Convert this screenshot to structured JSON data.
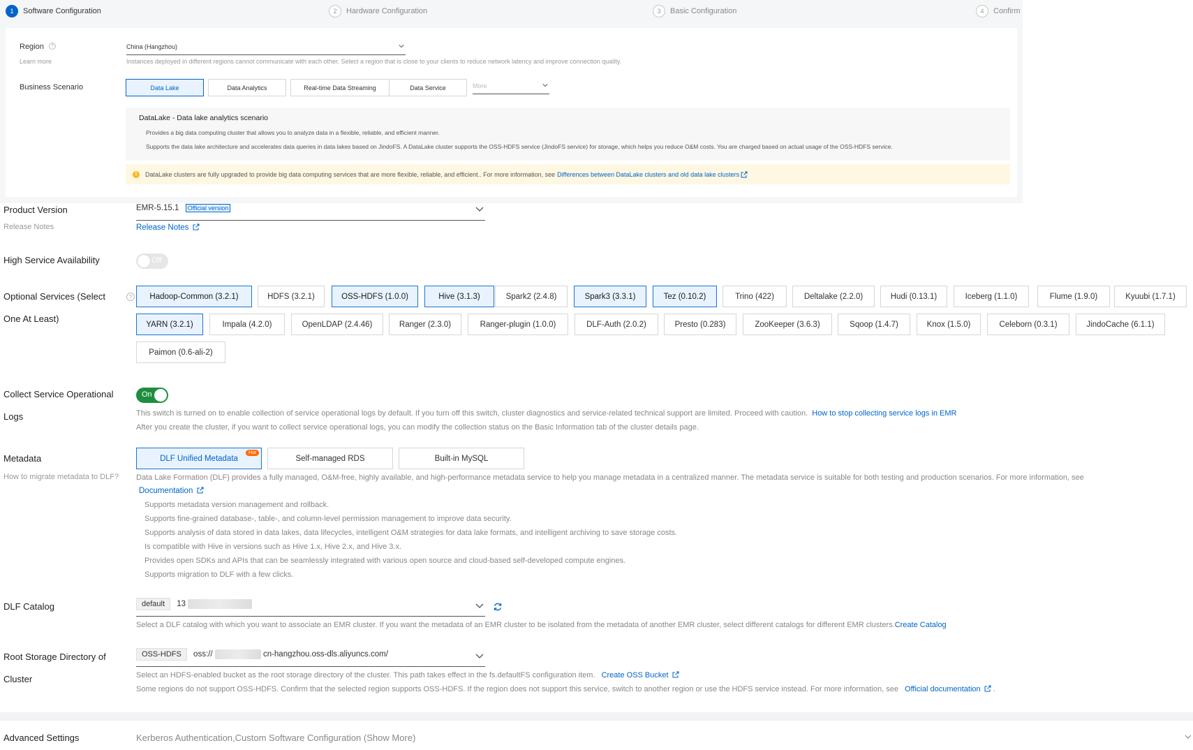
{
  "stepper": [
    {
      "num": "1",
      "label": "Software Configuration"
    },
    {
      "num": "2",
      "label": "Hardware Configuration"
    },
    {
      "num": "3",
      "label": "Basic Configuration"
    },
    {
      "num": "4",
      "label": "Confirm"
    }
  ],
  "region": {
    "label": "Region",
    "learn_more": "Learn more",
    "value": "China (Hangzhou)",
    "hint": "Instances deployed in different regions cannot communicate with each other. Select a region that is close to your clients to reduce network latency and improve connection quality."
  },
  "business": {
    "label": "Business Scenario",
    "options": [
      "Data Lake",
      "Data Analytics",
      "Real-time Data Streaming",
      "Data Service"
    ],
    "more_placeholder": "More",
    "scenario_title": "DataLake - Data lake analytics scenario",
    "scenario_line1": "Provides a big data computing cluster that allows you to analyze data in a flexible, reliable, and efficient manner.",
    "scenario_line2": "Supports the data lake architecture and accelerates data queries in data lakes based on JindoFS. A DataLake cluster supports the OSS-HDFS service (JindoFS service) for storage, which helps you reduce O&M costs. You are charged based on actual usage of the OSS-HDFS service.",
    "notice_text": "DataLake clusters are fully upgraded to provide big data computing services that are more flexible, reliable, and efficient.. For more information, see",
    "notice_link": "Differences between DataLake clusters and old data lake clusters"
  },
  "product_version": {
    "label": "Product Version",
    "sublabel": "Release Notes",
    "value": "EMR-5.15.1",
    "badge": "Official version",
    "link": "Release Notes"
  },
  "high_availability": {
    "label": "High Service Availability",
    "state": "Off"
  },
  "optional_services": {
    "label_line1": "Optional Services (Select",
    "label_line2": "One At Least)",
    "row1": [
      "Hadoop-Common (3.2.1)",
      "HDFS (3.2.1)",
      "OSS-HDFS (1.0.0)",
      "Hive (3.1.3)",
      "Spark2 (2.4.8)",
      "Spark3 (3.3.1)",
      "Tez (0.10.2)",
      "Trino (422)",
      "Deltalake (2.2.0)",
      "Hudi (0.13.1)",
      "Iceberg (1.1.0)",
      "Flume (1.9.0)",
      "Kyuubi (1.7.1)"
    ],
    "row2": [
      "YARN (3.2.1)",
      "Impala (4.2.0)",
      "OpenLDAP (2.4.46)",
      "Ranger (2.3.0)",
      "Ranger-plugin (1.0.0)",
      "DLF-Auth (2.0.2)",
      "Presto (0.283)",
      "ZooKeeper (3.6.3)",
      "Sqoop (1.4.7)",
      "Knox (1.5.0)",
      "Celeborn (0.3.1)",
      "JindoCache (6.1.1)"
    ],
    "row3": [
      "Paimon (0.6-ali-2)"
    ]
  },
  "collect_logs": {
    "label_line1": "Collect Service Operational",
    "label_line2": "Logs",
    "state": "On",
    "desc1": "This switch is turned on to enable collection of service operational logs by default. If you turn off this switch, cluster diagnostics and service-related technical support are limited. Proceed with caution.",
    "desc1_link": "How to stop collecting service logs in EMR",
    "desc2": "After you create the cluster, if you want to collect service operational logs, you can modify the collection status on the Basic Information tab of the cluster details page."
  },
  "metadata": {
    "label": "Metadata",
    "sublabel": "How to migrate metadata to DLF?",
    "options": [
      "DLF Unified Metadata",
      "Self-managed RDS",
      "Built-in MySQL"
    ],
    "hot": "Hot",
    "desc": "Data Lake Formation (DLF) provides a fully managed, O&M-free, highly available, and high-performance metadata service to help you manage metadata in a centralized manner. The metadata service is suitable for both testing and production scenarios. For more information, see",
    "doc_link": "Documentation",
    "bullets": [
      "Supports metadata version management and rollback.",
      "Supports fine-grained database-, table-, and column-level permission management to improve data security.",
      "Supports analysis of data stored in data lakes, data lifecycles, intelligent O&M strategies for data lake formats, and intelligent archiving to save storage costs.",
      "Is compatible with Hive in versions such as Hive 1.x, Hive 2.x, and Hive 3.x.",
      "Provides open SDKs and APIs that can be seamlessly integrated with various open source and cloud-based self-developed compute engines.",
      "Supports migration to DLF with a few clicks."
    ]
  },
  "dlf_catalog": {
    "label": "DLF Catalog",
    "tag": "default",
    "value": "13",
    "desc": "Select a DLF catalog with which you want to associate an EMR cluster. If you want the metadata of an EMR cluster to be isolated from the metadata of another EMR cluster, select different catalogs for different EMR clusters.",
    "link": "Create Catalog"
  },
  "root_storage": {
    "label_line1": "Root Storage Directory of",
    "label_line2": "Cluster",
    "tag": "OSS-HDFS",
    "value_prefix": "oss://",
    "value_suffix": "cn-hangzhou.oss-dls.aliyuncs.com/",
    "desc1": "Select an HDFS-enabled bucket as the root storage directory of the cluster. This path takes effect in the fs.defaultFS configuration item.",
    "desc1_link": "Create OSS Bucket",
    "desc2": "Some regions do not support OSS-HDFS. Confirm that the selected region supports OSS-HDFS. If the region does not support this service, switch to another region or use the HDFS service instead. For more information, see",
    "desc2_link": "Official documentation",
    "desc2_end": "."
  },
  "advanced": {
    "label": "Advanced Settings",
    "summary": "Kerberos Authentication,Custom Software Configuration (Show More)"
  }
}
